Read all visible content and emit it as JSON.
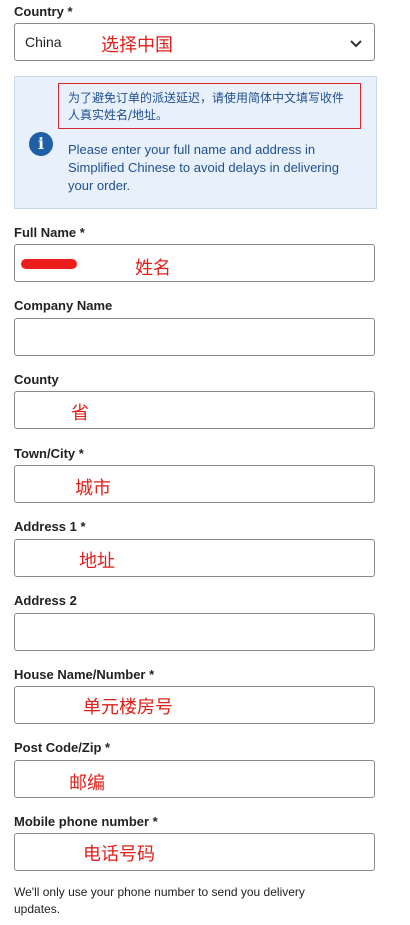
{
  "country": {
    "label": "Country *",
    "value": "China",
    "annotation": "选择中国",
    "icon": "chevron-down-icon"
  },
  "info": {
    "icon": "info-icon",
    "chinese_note": "为了避免订单的派送延迟，请使用简体中文填写收件人真实姓名/地址。",
    "english_note": "Please enter your full name and address in Simplified Chinese to avoid delays in delivering your order."
  },
  "fields": {
    "full_name": {
      "label": "Full Name *",
      "annotation": "姓名"
    },
    "company": {
      "label": "Company Name",
      "annotation": ""
    },
    "county": {
      "label": "County",
      "annotation": "省"
    },
    "town": {
      "label": "Town/City *",
      "annotation": "城市"
    },
    "address1": {
      "label": "Address 1 *",
      "annotation": "地址"
    },
    "address2": {
      "label": "Address 2",
      "annotation": ""
    },
    "house": {
      "label": "House Name/Number *",
      "annotation": "单元楼房号"
    },
    "postcode": {
      "label": "Post Code/Zip *",
      "annotation": "邮编"
    },
    "mobile": {
      "label": "Mobile phone number *",
      "annotation": "电话号码"
    }
  },
  "footer": {
    "note": "We'll only use your phone number to send you delivery updates."
  },
  "colors": {
    "annotation_red": "#e0201b",
    "info_blue": "#1f5fa8",
    "info_bg": "#e8f1fb"
  }
}
